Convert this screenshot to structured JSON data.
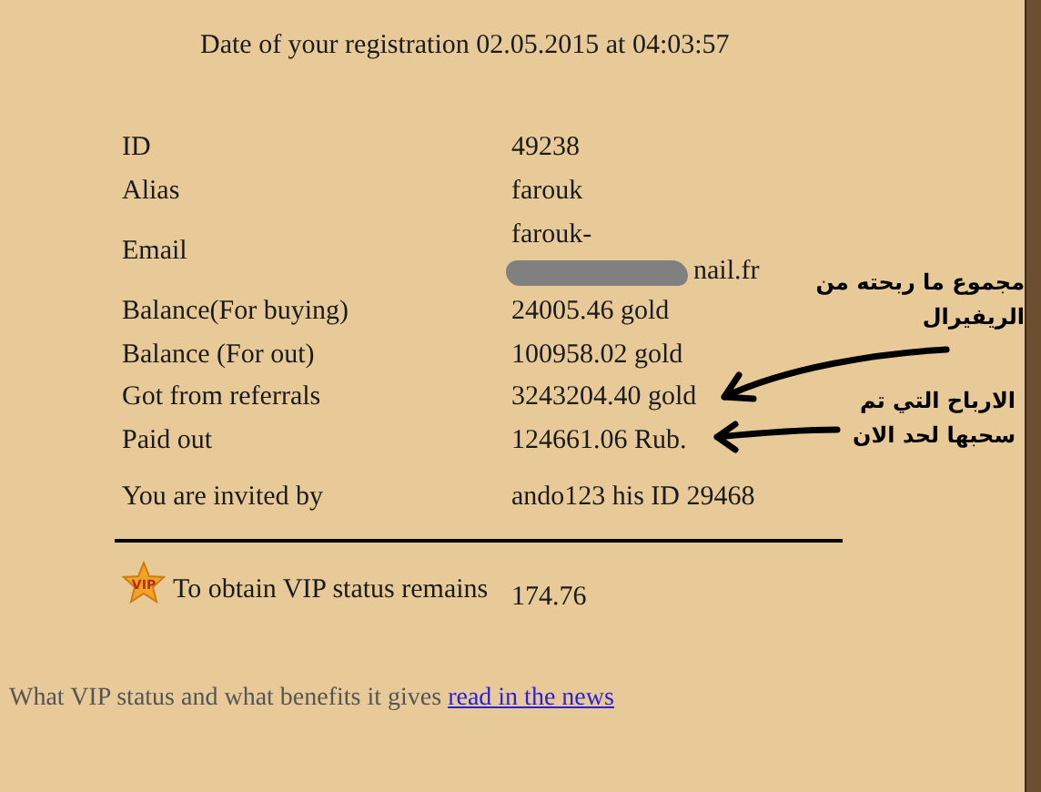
{
  "header": "Date of your registration 02.05.2015 at 04:03:57",
  "rows": [
    {
      "label": "ID",
      "value": [
        "49238"
      ]
    },
    {
      "label": "Alias",
      "value": [
        "farouk"
      ]
    },
    {
      "label": "Email",
      "value": [
        "farouk-",
        "nail.fr"
      ],
      "redacted": true
    },
    {
      "label": "Balance(For buying)",
      "value": [
        "24005.46 gold"
      ]
    },
    {
      "label": "Balance (For out)",
      "value": [
        "100958.02 gold"
      ]
    },
    {
      "label": "Got from referrals",
      "value": [
        "3243204.40 gold"
      ]
    },
    {
      "label": "Paid out",
      "value": [
        "124661.06 Rub."
      ]
    },
    {
      "label": "You are invited by",
      "value": [
        "ando123 his ID 29468"
      ]
    }
  ],
  "vip": {
    "badge": "VIP",
    "label": "To obtain VIP status remains",
    "value": "174.76"
  },
  "footer": {
    "text": "What VIP status and what benefits it gives",
    "link": "read in the news"
  },
  "annotations": [
    {
      "text": "مجموع ما ربحته من الريفيرال"
    },
    {
      "text": "الارباح التي تم سحبها لحد الان"
    }
  ]
}
